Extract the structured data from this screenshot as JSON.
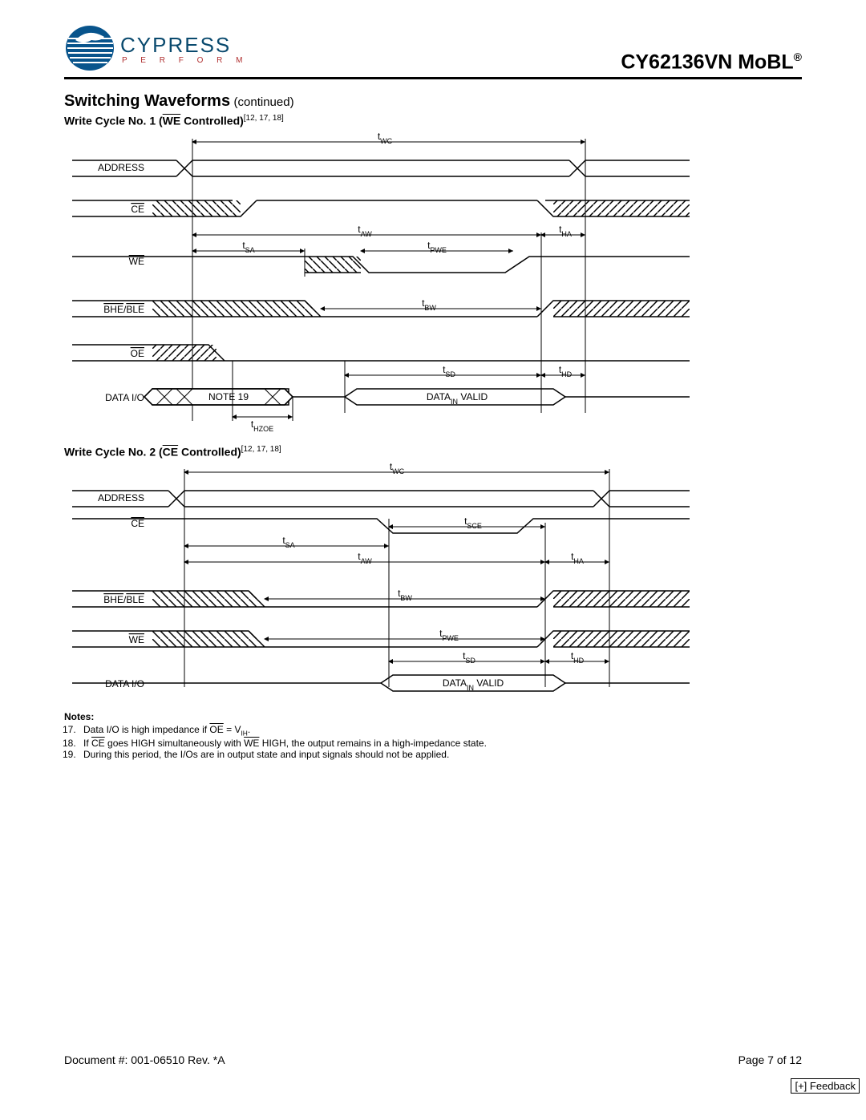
{
  "header": {
    "brand": "CYPRESS",
    "brand_sub": "P E R F O R M",
    "part": "CY62136VN MoBL",
    "reg": "®"
  },
  "section": {
    "title": "Switching Waveforms",
    "continued": "(continued)"
  },
  "cycle1": {
    "title_pre": "Write Cycle No. 1 (",
    "title_bar": "WE",
    "title_post": " Controlled)",
    "refs": "[12, 17, 18]",
    "signals": {
      "address": "ADDRESS",
      "ce": "CE",
      "we": "WE",
      "bhe_ble": "BHE/BLE",
      "oe": "OE",
      "dataio": "DATA I/O"
    },
    "timing": {
      "twc": "tWC",
      "taw": "tAW",
      "tha": "tHA",
      "tsa": "tSA",
      "tpwe": "tPWE",
      "tbw": "tBW",
      "tsd": "tSD",
      "thd": "tHD",
      "thzoe": "tHZOE"
    },
    "note19": "NOTE 19",
    "data_valid_pre": "DATA",
    "data_valid_sub": "IN",
    "data_valid_post": " VALID"
  },
  "cycle2": {
    "title_pre": "Write Cycle No. 2 (",
    "title_bar": "CE",
    "title_post": " Controlled)",
    "refs": "[12, 17, 18]",
    "signals": {
      "address": "ADDRESS",
      "ce": "CE",
      "bhe_ble": "BHE/BLE",
      "we": "WE",
      "dataio": "DATA I/O"
    },
    "timing": {
      "twc": "tWC",
      "tsce": "tSCE",
      "tsa": "tSA",
      "taw": "tAW",
      "tha": "tHA",
      "tbw": "tBW",
      "tpwe": "tPWE",
      "tsd": "tSD",
      "thd": "tHD"
    },
    "data_valid_pre": "DATA",
    "data_valid_sub": "IN",
    "data_valid_post": " VALID"
  },
  "notes": {
    "heading": "Notes:",
    "n17_a": "Data I/O is high impedance if ",
    "n17_oe": "OE",
    "n17_b": " = V",
    "n17_sub": "IH",
    "n17_c": ".",
    "n18_a": "If ",
    "n18_ce": "CE",
    "n18_b": " goes HIGH simultaneously with ",
    "n18_we": "WE",
    "n18_c": " HIGH, the output remains in a high-impedance state.",
    "n19": "During this period, the I/Os are in output state and input signals should not be applied."
  },
  "footer": {
    "doc": "Document #: 001-06510 Rev. *A",
    "page": "Page 7 of 12",
    "feedback": "[+] Feedback"
  },
  "chart_data": [
    {
      "type": "timing-diagram",
      "title": "Write Cycle No. 1 (WE Controlled)",
      "signals": [
        "ADDRESS",
        "CE",
        "WE",
        "BHE/BLE",
        "OE",
        "DATA I/O"
      ],
      "timing_params": [
        "tWC",
        "tAW",
        "tHA",
        "tSA",
        "tPWE",
        "tBW",
        "tSD",
        "tHD",
        "tHZOE"
      ],
      "annotations": [
        "NOTE 19",
        "DATA_IN VALID"
      ]
    },
    {
      "type": "timing-diagram",
      "title": "Write Cycle No. 2 (CE Controlled)",
      "signals": [
        "ADDRESS",
        "CE",
        "BHE/BLE",
        "WE",
        "DATA I/O"
      ],
      "timing_params": [
        "tWC",
        "tSCE",
        "tSA",
        "tAW",
        "tHA",
        "tBW",
        "tPWE",
        "tSD",
        "tHD"
      ],
      "annotations": [
        "DATA_IN VALID"
      ]
    }
  ]
}
